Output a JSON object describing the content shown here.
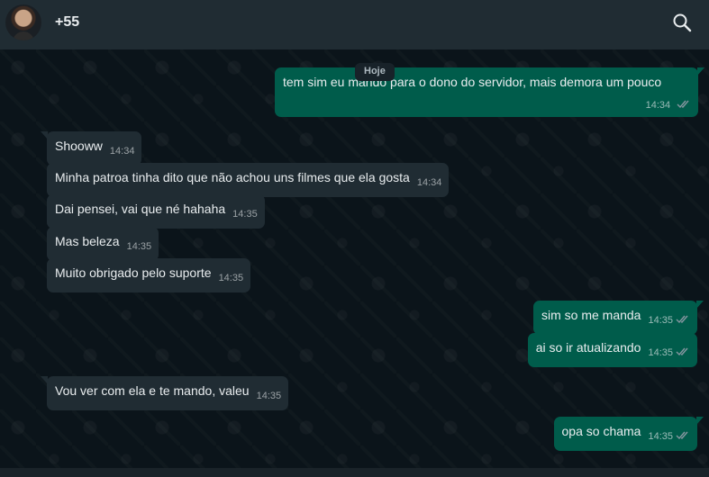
{
  "header": {
    "contact_name": "+55",
    "avatar_icon": "profile-photo",
    "search_icon": "search-icon"
  },
  "chat": {
    "date_divider": "Hoje",
    "messages": [
      {
        "direction": "out",
        "text": "tem sim eu mando para o dono do servidor, mais demora um pouco",
        "time": "14:34",
        "status": "read"
      },
      {
        "direction": "in",
        "text": "Shooww",
        "time": "14:34"
      },
      {
        "direction": "in",
        "text": "Minha patroa tinha dito que não achou uns filmes que ela gosta",
        "time": "14:34"
      },
      {
        "direction": "in",
        "text": "Dai pensei, vai que né hahaha",
        "time": "14:35"
      },
      {
        "direction": "in",
        "text": "Mas beleza",
        "time": "14:35"
      },
      {
        "direction": "in",
        "text": "Muito obrigado pelo suporte",
        "time": "14:35"
      },
      {
        "direction": "out",
        "text": "sim so me manda",
        "time": "14:35",
        "status": "read"
      },
      {
        "direction": "out",
        "text": "ai so ir atualizando",
        "time": "14:35",
        "status": "read"
      },
      {
        "direction": "in",
        "text": "Vou ver com ela e te mando, valeu",
        "time": "14:35"
      },
      {
        "direction": "out",
        "text": "opa so chama",
        "time": "14:35",
        "status": "read"
      }
    ]
  },
  "colors": {
    "header_bg": "#202c33",
    "chat_bg": "#0b141a",
    "incoming_bubble": "#202c33",
    "outgoing_bubble": "#005c4b",
    "read_ticks": "#8696a0"
  }
}
